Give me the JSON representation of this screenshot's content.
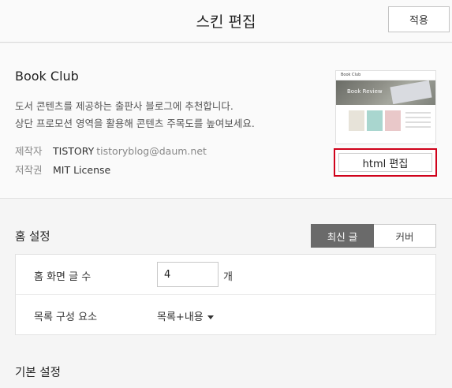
{
  "header": {
    "title": "스킨 편집",
    "apply_label": "적용"
  },
  "skin": {
    "name": "Book Club",
    "description_line1": "도서 콘텐츠를 제공하는 출판사 블로그에 추천합니다.",
    "description_line2": "상단 프로모션 영역을 활용해 콘텐츠 주목도를 높여보세요.",
    "author_label": "제작자",
    "author_name": "TISTORY",
    "author_email": "tistoryblog@daum.net",
    "license_label": "저작권",
    "license_value": "MIT License",
    "thumbnail_brand": "Book Club",
    "thumbnail_hero_text": "Book Review",
    "edit_html_label": "html 편집"
  },
  "home_settings": {
    "title": "홈 설정",
    "segment": {
      "options": [
        "최신 글",
        "커버"
      ],
      "selected": "최신 글"
    },
    "post_count_label": "홈 화면 글 수",
    "post_count_value": "4",
    "post_count_unit": "개",
    "list_composition_label": "목록 구성 요소",
    "list_composition_value": "목록+내용"
  },
  "basic_settings": {
    "title": "기본 설정"
  },
  "colors": {
    "highlight": "#d0021b",
    "active_segment": "#6a6a6a"
  },
  "icons": {
    "dropdown": "caret-down-icon"
  }
}
